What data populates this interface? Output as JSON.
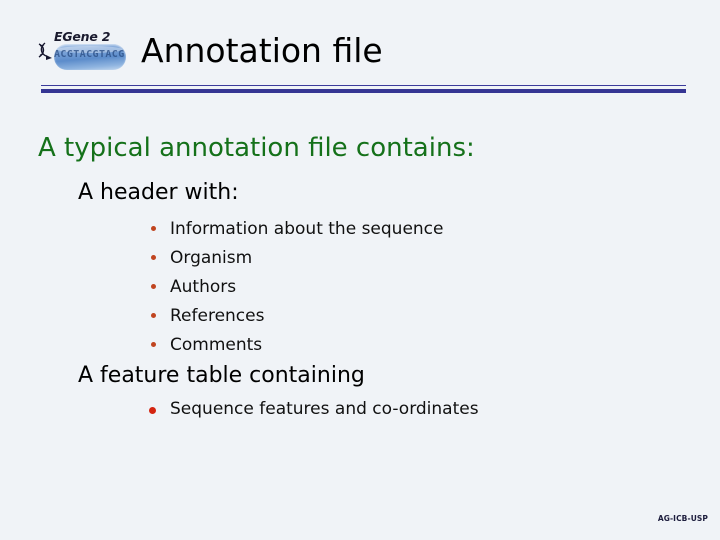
{
  "slide": {
    "background_color": "#f0f3f7",
    "title": "Annotation file",
    "title_color": "#000000",
    "divider_color": "#353593"
  },
  "logo": {
    "brand": "EGene 2",
    "sequence_text": "ACGTACGTACGT",
    "capsule_color": "#5c8ccb",
    "helix_icon": "dna-helix-icon"
  },
  "content": {
    "level1": {
      "text": "A typical annotation file contains:",
      "color": "#15711a"
    },
    "level2": {
      "text": "A header with:",
      "color": "#000000"
    },
    "bullets": [
      {
        "text": "Information about the sequence"
      },
      {
        "text": "Organism"
      },
      {
        "text": "Authors"
      },
      {
        "text": "References"
      },
      {
        "text": "Comments"
      }
    ],
    "bullet_color": "#c0441f",
    "level2_second": {
      "text": "A feature table containing",
      "color": "#000000"
    },
    "feature_bullet": {
      "text": "Sequence features and co-ordinates",
      "bullet_color": "#d42410"
    }
  },
  "footer": {
    "text": "AG-ICB-USP"
  }
}
